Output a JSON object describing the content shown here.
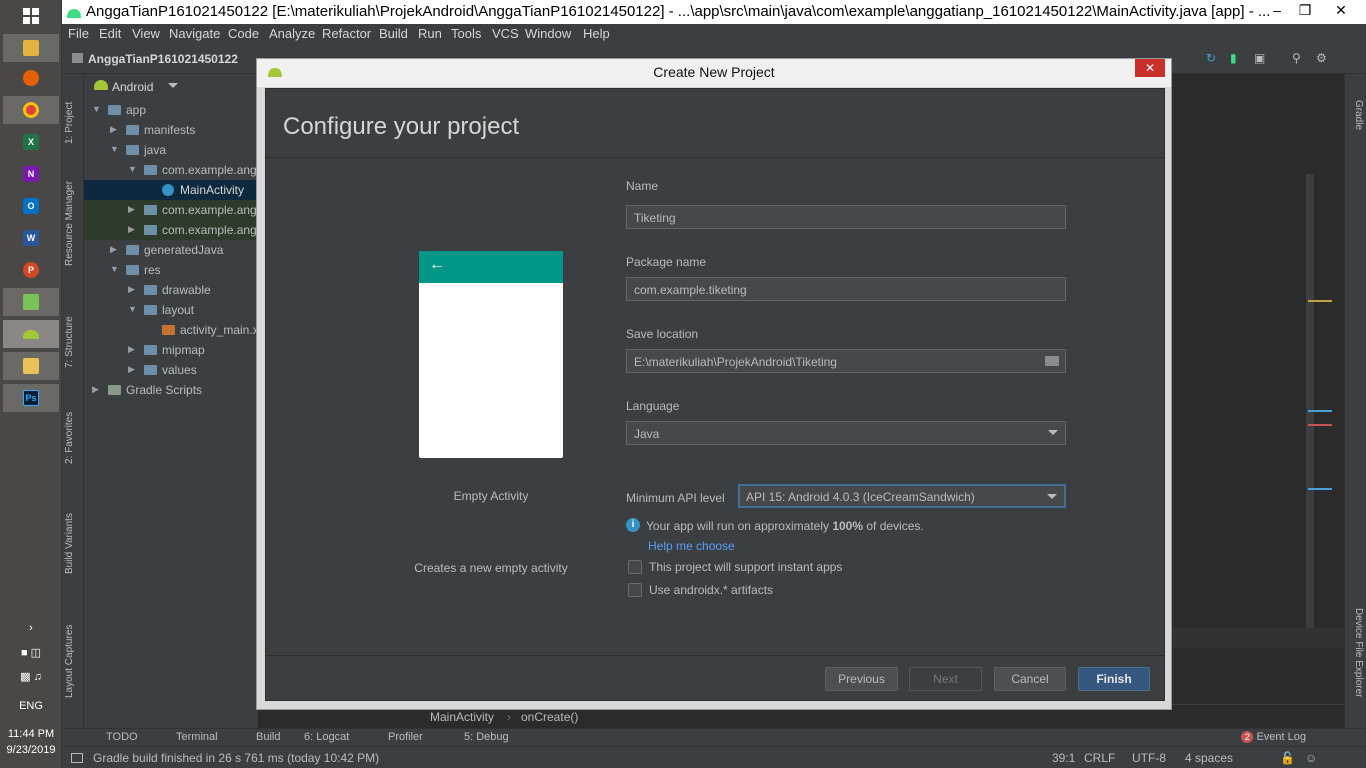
{
  "taskbar": {
    "time": "11:44 PM",
    "date": "9/23/2019",
    "language": "ENG"
  },
  "window": {
    "title": "AnggaTianP161021450122 [E:\\materikuliah\\ProjekAndroid\\AnggaTianP161021450122] - ...\\app\\src\\main\\java\\com\\example\\anggatianp_161021450122\\MainActivity.java [app] - ...",
    "minimize": "–",
    "maximize": "❐",
    "close": "✕"
  },
  "menu": [
    "File",
    "Edit",
    "View",
    "Navigate",
    "Code",
    "Analyze",
    "Refactor",
    "Build",
    "Run",
    "Tools",
    "VCS",
    "Window",
    "Help"
  ],
  "navbar": {
    "project": "AnggaTianP161021450122"
  },
  "project_panel": {
    "view": "Android",
    "tree": [
      {
        "label": "app",
        "indent": 0,
        "arrow": "▼",
        "kind": "folder"
      },
      {
        "label": "manifests",
        "indent": 1,
        "arrow": "▶",
        "kind": "folder"
      },
      {
        "label": "java",
        "indent": 1,
        "arrow": "▼",
        "kind": "folder"
      },
      {
        "label": "com.example.angg",
        "indent": 2,
        "arrow": "▼",
        "kind": "folder"
      },
      {
        "label": "MainActivity",
        "indent": 3,
        "arrow": "",
        "kind": "class",
        "selected": true
      },
      {
        "label": "com.example.angg",
        "indent": 2,
        "arrow": "▶",
        "kind": "folder",
        "green": true
      },
      {
        "label": "com.example.angg",
        "indent": 2,
        "arrow": "▶",
        "kind": "folder",
        "green": true
      },
      {
        "label": "generatedJava",
        "indent": 1,
        "arrow": "▶",
        "kind": "folder"
      },
      {
        "label": "res",
        "indent": 1,
        "arrow": "▼",
        "kind": "folder"
      },
      {
        "label": "drawable",
        "indent": 2,
        "arrow": "▶",
        "kind": "folder"
      },
      {
        "label": "layout",
        "indent": 2,
        "arrow": "▼",
        "kind": "folder"
      },
      {
        "label": "activity_main.x",
        "indent": 3,
        "arrow": "",
        "kind": "file"
      },
      {
        "label": "mipmap",
        "indent": 2,
        "arrow": "▶",
        "kind": "folder"
      },
      {
        "label": "values",
        "indent": 2,
        "arrow": "▶",
        "kind": "folder"
      },
      {
        "label": "Gradle Scripts",
        "indent": 0,
        "arrow": "▶",
        "kind": "gradle"
      }
    ]
  },
  "left_tool_tabs": [
    "1: Project",
    "Resource Manager",
    "7: Structure",
    "2: Favorites",
    "Build Variants",
    "Layout Captures"
  ],
  "right_tool_tabs": [
    "Gradle",
    "Device File Explorer"
  ],
  "editor_breadcrumb": {
    "class": "MainActivity",
    "method": "onCreate()"
  },
  "bottom_tools": [
    "TODO",
    "Terminal",
    "Build",
    "6: Logcat",
    "Profiler",
    "5: Debug"
  ],
  "event_log": {
    "count": "2",
    "label": "Event Log"
  },
  "status": {
    "message": "Gradle build finished in 26 s 761 ms (today 10:42 PM)",
    "position": "39:1",
    "line_sep": "CRLF",
    "encoding": "UTF-8",
    "indent": "4 spaces"
  },
  "dialog": {
    "title": "Create New Project",
    "heading": "Configure your project",
    "template_name": "Empty Activity",
    "template_desc": "Creates a new empty activity",
    "name_label": "Name",
    "name_value": "Tiketing",
    "package_label": "Package name",
    "package_value": "com.example.tiketing",
    "save_label": "Save location",
    "save_value": "E:\\materikuliah\\ProjekAndroid\\Tiketing",
    "language_label": "Language",
    "language_value": "Java",
    "min_api_label": "Minimum API level",
    "min_api_value": "API 15: Android 4.0.3 (IceCreamSandwich)",
    "info_prefix": "Your app will run on approximately ",
    "info_percent": "100%",
    "info_suffix": " of devices.",
    "help_link": "Help me choose",
    "instant_apps_label": "This project will support instant apps",
    "androidx_label": "Use androidx.* artifacts",
    "btn_previous": "Previous",
    "btn_next": "Next",
    "btn_cancel": "Cancel",
    "btn_finish": "Finish",
    "preview_bar_color": "#009688"
  }
}
